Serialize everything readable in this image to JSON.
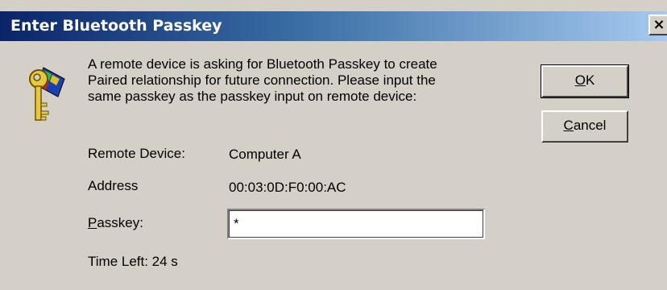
{
  "window": {
    "title": "Enter Bluetooth Passkey",
    "close_label": "×"
  },
  "icon": {
    "name": "key-bluetooth-icon"
  },
  "message": {
    "lines": [
      "A remote device is asking for Bluetooth Passkey to create",
      "Paired relationship for future connection. Please input the",
      "same passkey as the passkey input on remote device:"
    ]
  },
  "fields": {
    "remote_device_label": "Remote Device:",
    "remote_device_value": "Computer A",
    "address_label": "Address",
    "address_value": "00:03:0D:F0:00:AC",
    "passkey_label_first": "P",
    "passkey_label_rest": "asskey:",
    "passkey_value": "*"
  },
  "status": {
    "time_left": "Time Left: 24 s"
  },
  "buttons": {
    "ok_first": "O",
    "ok_rest": "K",
    "cancel_first": "C",
    "cancel_rest": "ancel"
  },
  "colors": {
    "title_gradient_start": "#0a246a",
    "title_gradient_end": "#a6caf0",
    "dialog_bg": "#d4d0c8"
  }
}
